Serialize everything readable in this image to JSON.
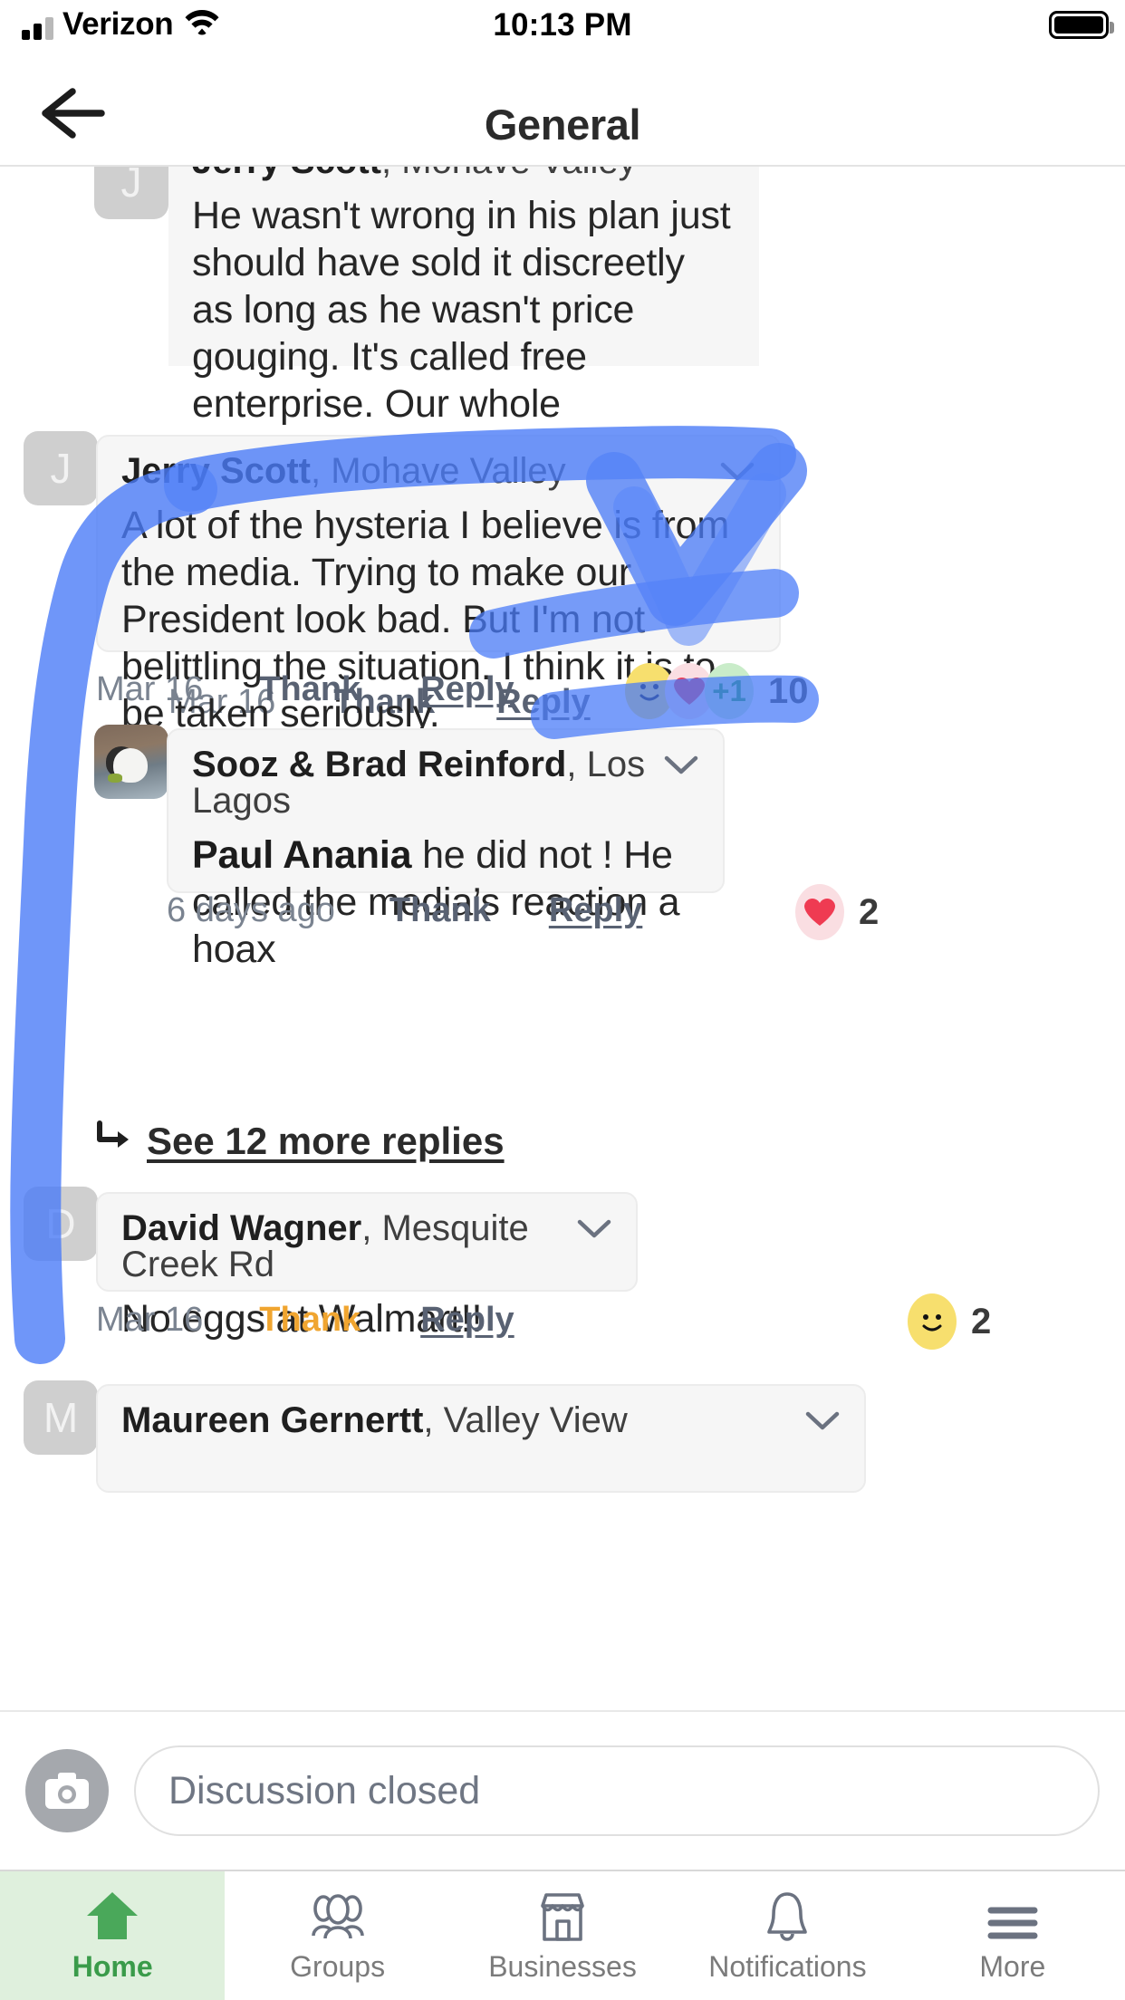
{
  "status_bar": {
    "carrier": "Verizon",
    "time": "10:13 PM",
    "signal_icon": "cellular-signal-icon",
    "wifi_icon": "wifi-icon",
    "battery_icon": "battery-full-icon"
  },
  "nav": {
    "back_icon": "back-arrow-icon",
    "title": "General"
  },
  "comments": [
    {
      "avatar_initial": "J",
      "name": "Jerry Scott",
      "neighborhood": ", Mohave Valley",
      "body": "He wasn't wrong in his plan just should have sold it discreetly as long as he wasn't price gouging. It's called free enterprise. Our whole economic system is built on that",
      "timestamp": "Mar 16",
      "thank_label": "Thank",
      "reply_label": "Reply",
      "thank_active": false,
      "reactions": [],
      "reaction_count": ""
    },
    {
      "avatar_initial": "J",
      "name": "Jerry Scott",
      "neighborhood": ", Mohave Valley",
      "body": "A lot of the hysteria I believe is from the media. Trying to make our President look bad. But I'm not belittling the situation. I think it is to be taken seriously.",
      "timestamp": "Mar 16",
      "thank_label": "Thank",
      "reply_label": "Reply",
      "thank_active": false,
      "reactions": [
        "smile-reaction-icon",
        "heart-reaction-icon",
        "plus-one-reaction-icon"
      ],
      "reaction_count": "10"
    },
    {
      "avatar_initial": "",
      "name": "Sooz & Brad Reinford",
      "neighborhood": ", Los Lagos",
      "mention": "Paul Anania",
      "body": " he did not ! He called the media’s reaction a hoax",
      "timestamp": "6 days ago",
      "thank_label": "Thank",
      "reply_label": "Reply",
      "thank_active": false,
      "reactions": [
        "heart-reaction-icon"
      ],
      "reaction_count": "2"
    },
    {
      "avatar_initial": "D",
      "name": "David Wagner",
      "neighborhood": ", Mesquite Creek Rd",
      "body": "No eggs at Walmart!!",
      "timestamp": "Mar 16",
      "thank_label": "Thank",
      "reply_label": "Reply",
      "thank_active": true,
      "reactions": [
        "smile-reaction-icon"
      ],
      "reaction_count": "2"
    },
    {
      "avatar_initial": "M",
      "name": "Maureen Gernertt",
      "neighborhood": ", Valley View",
      "body": "",
      "timestamp": "",
      "thank_label": "",
      "reply_label": "",
      "thank_active": false,
      "reactions": [],
      "reaction_count": ""
    }
  ],
  "see_more": {
    "arrow_icon": "reply-arrow-icon",
    "label": "See 12 more replies"
  },
  "composer": {
    "camera_icon": "camera-icon",
    "placeholder": "Discussion closed"
  },
  "tabbar": {
    "items": [
      {
        "label": "Home",
        "icon": "home-icon",
        "active": true
      },
      {
        "label": "Groups",
        "icon": "groups-icon",
        "active": false
      },
      {
        "label": "Businesses",
        "icon": "storefront-icon",
        "active": false
      },
      {
        "label": "Notifications",
        "icon": "bell-icon",
        "active": false
      },
      {
        "label": "More",
        "icon": "hamburger-menu-icon",
        "active": false
      }
    ]
  },
  "annotations": {
    "ink_color": "#4a7bf7",
    "strokes": [
      "left-bracket-stroke",
      "checkmark-stroke",
      "underline-stroke-1",
      "underline-stroke-2"
    ]
  }
}
